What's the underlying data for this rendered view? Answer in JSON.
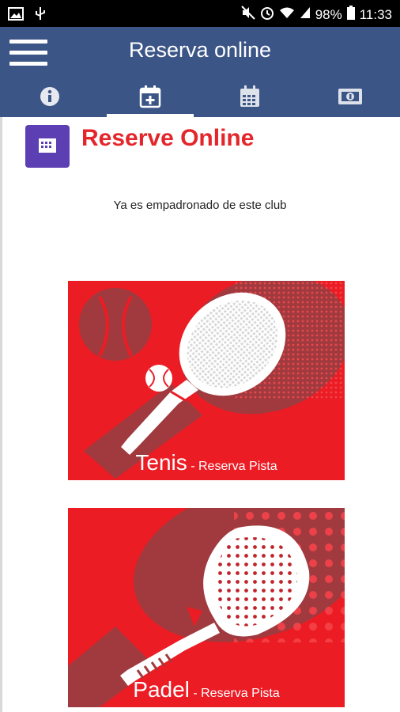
{
  "status_bar": {
    "battery": "98%",
    "time": "11:33",
    "left_icons": [
      "gallery-icon",
      "usb-icon"
    ],
    "right_icons": [
      "mute-icon",
      "alarm-icon",
      "wifi-icon",
      "signal-icon",
      "battery-icon"
    ]
  },
  "app_bar": {
    "title": "Reserva online",
    "menu_icon": "hamburger-menu-icon",
    "tabs": [
      {
        "icon": "info-icon",
        "active": false
      },
      {
        "icon": "calendar-add-icon",
        "active": true
      },
      {
        "icon": "calendar-icon",
        "active": false
      },
      {
        "icon": "cash-icon",
        "active": false
      }
    ]
  },
  "page": {
    "heading": "Reserve Online",
    "heading_icon": "calendar-booking-icon",
    "notice": "Ya es empadronado de este club"
  },
  "cards": [
    {
      "sport": "Tenis",
      "subtitle": " - Reserva Pista",
      "image_icon": "tennis-racket-icon"
    },
    {
      "sport": "Padel",
      "subtitle": " - Reserva Pista",
      "image_icon": "padel-racket-icon"
    }
  ],
  "colors": {
    "app_bar": "#3c5587",
    "accent_red": "#ec1c24",
    "heading_red": "#e4262b",
    "icon_purple": "#5b3fb3"
  }
}
